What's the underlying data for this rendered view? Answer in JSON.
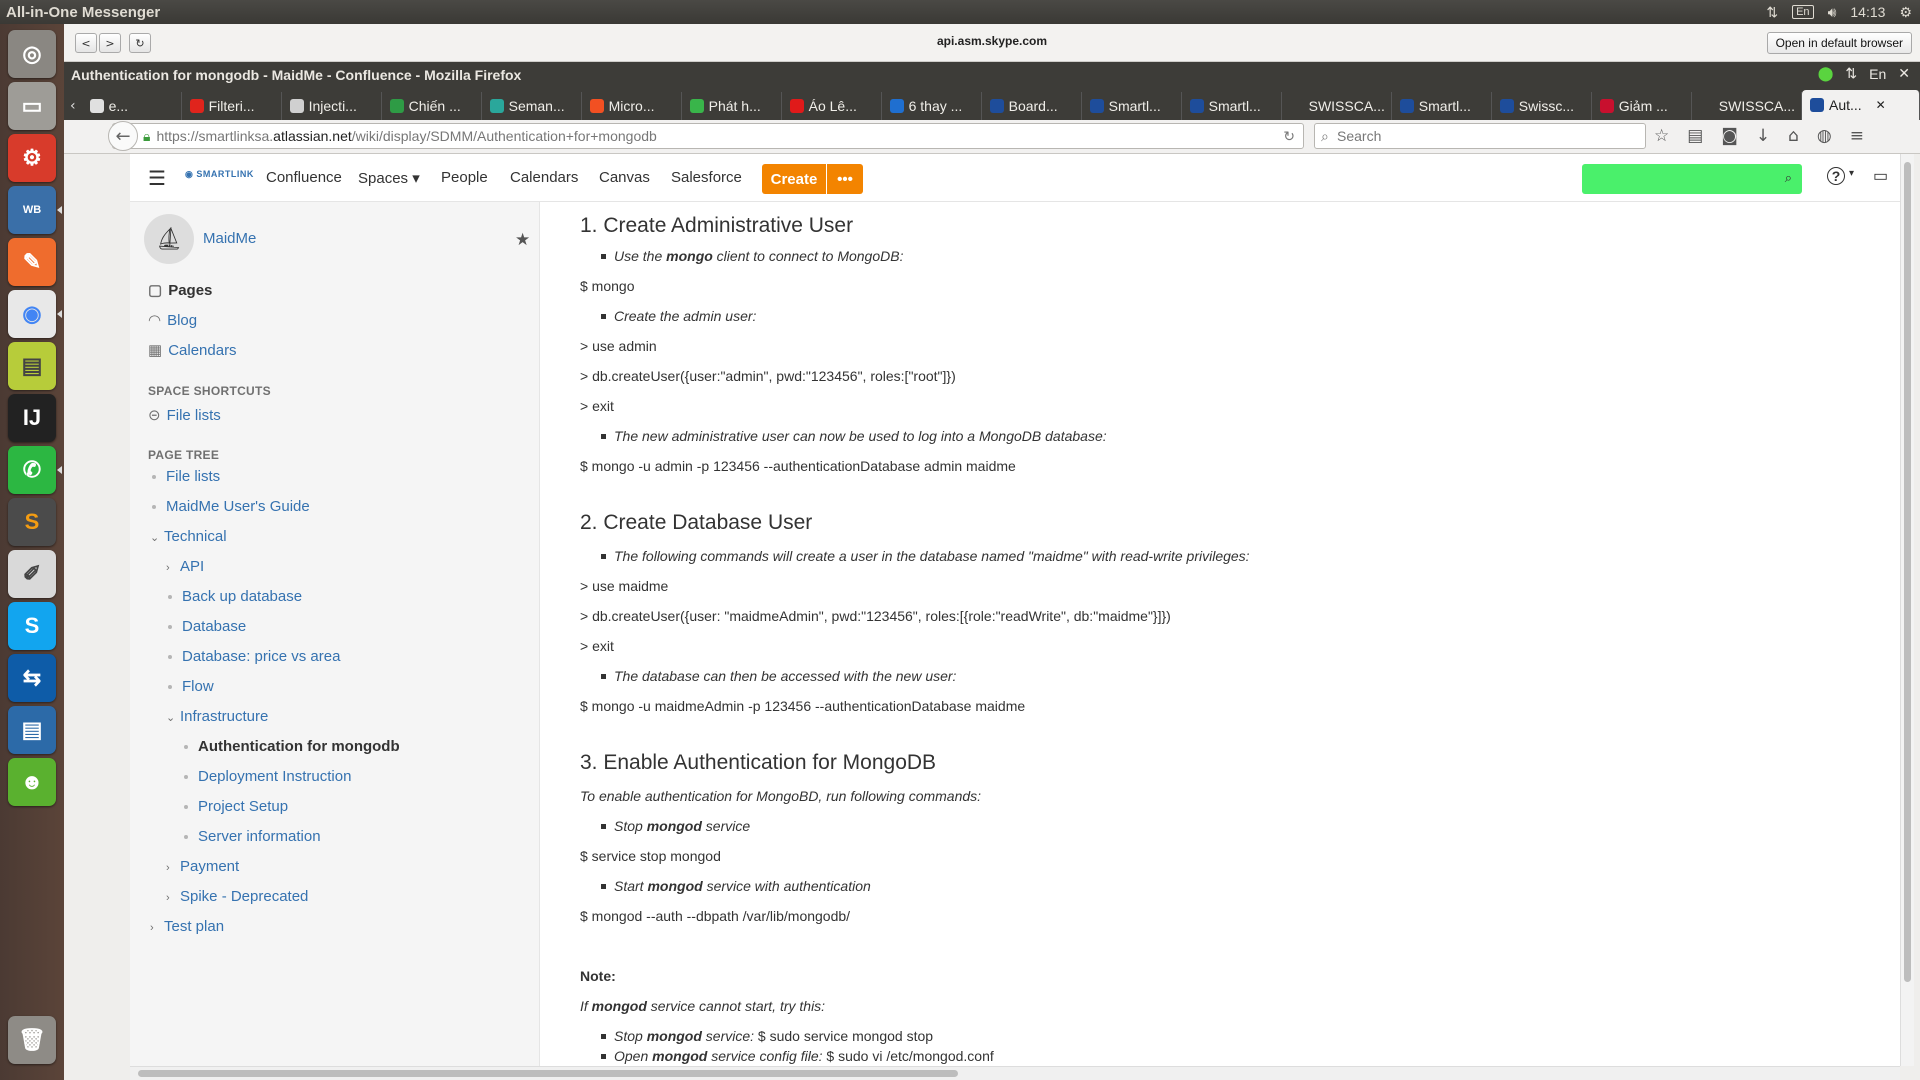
{
  "os": {
    "panel_title": "All-in-One Messenger",
    "lang": "En",
    "clock": "14:13"
  },
  "skype": {
    "url": "api.asm.skype.com",
    "open_default": "Open in default browser",
    "back": "<",
    "forward": ">",
    "reload": "↻"
  },
  "firefox": {
    "window_title": "Authentication for mongodb - MaidMe - Confluence - Mozilla Firefox",
    "address_pre": "https://smartlinksa.",
    "address_host": "atlassian.net",
    "address_post": "/wiki/display/SDMM/Authentication+for+mongodb",
    "search_placeholder": "Search",
    "tabs": [
      {
        "label": "e...",
        "color": "#e0e0e0"
      },
      {
        "label": "Filteri...",
        "color": "#e0241c"
      },
      {
        "label": "Injecti...",
        "color": "#d0d0d0"
      },
      {
        "label": "Chiến ...",
        "color": "#2e9b45"
      },
      {
        "label": "Seman...",
        "color": "#2aa79b"
      },
      {
        "label": "Micro...",
        "color": "#f25022"
      },
      {
        "label": "Phát h...",
        "color": "#39b54a"
      },
      {
        "label": "Áo Lê...",
        "color": "#e01a1a"
      },
      {
        "label": "6 thay ...",
        "color": "#1f6fd0"
      },
      {
        "label": "Board...",
        "color": "#1e4d9b"
      },
      {
        "label": "Smartl...",
        "color": "#1e4d9b"
      },
      {
        "label": "Smartl...",
        "color": "#1e4d9b"
      },
      {
        "label": "SWISSCA...",
        "color": "#3d3c38"
      },
      {
        "label": "Smartl...",
        "color": "#1e4d9b"
      },
      {
        "label": "Swissc...",
        "color": "#1e4d9b"
      },
      {
        "label": "Giảm ...",
        "color": "#c8102e"
      },
      {
        "label": "SWISSCA...",
        "color": "#3d3c38"
      },
      {
        "label": "Aut...",
        "color": "#1e4d9b"
      }
    ]
  },
  "confluence": {
    "brand": "SMARTLINK",
    "nav": [
      "Confluence",
      "Spaces",
      "People",
      "Calendars",
      "Canvas",
      "Salesforce"
    ],
    "create": "Create",
    "create_more": "•••",
    "help": "?",
    "space_name": "MaidMe",
    "sidebar": {
      "pages": "Pages",
      "blog": "Blog",
      "calendars": "Calendars",
      "shortcuts_header": "SPACE SHORTCUTS",
      "file_lists_shortcut": "File lists",
      "tree_header": "PAGE TREE",
      "tree": [
        {
          "label": "File lists"
        },
        {
          "label": "MaidMe User's Guide"
        },
        {
          "label": "Technical"
        },
        {
          "label": "API"
        },
        {
          "label": "Back up database"
        },
        {
          "label": "Database"
        },
        {
          "label": "Database: price vs area"
        },
        {
          "label": "Flow"
        },
        {
          "label": "Infrastructure"
        },
        {
          "label": "Authentication for mongodb"
        },
        {
          "label": "Deployment Instruction"
        },
        {
          "label": "Project Setup"
        },
        {
          "label": "Server information"
        },
        {
          "label": "Payment"
        },
        {
          "label": "Spike - Deprecated"
        },
        {
          "label": "Test plan"
        }
      ]
    },
    "content": {
      "h1": "1. Create Administrative User",
      "l1_pre": "Use the ",
      "l1_bold": "mongo",
      "l1_post": " client to connect to MongoDB:",
      "c1": "$ mongo",
      "l2": "Create the admin user:",
      "c2": "> use admin",
      "c3": "> db.createUser({user:\"admin\", pwd:\"123456\", roles:[\"root\"]})",
      "c4": "> exit",
      "l3": "The new administrative user can now be used to log into a MongoDB database:",
      "c5": "$ mongo -u admin -p 123456 --authenticationDatabase admin maidme",
      "h2": "2. Create Database User",
      "l4": "The following commands will create a user in the database named \"maidme\" with read-write privileges:",
      "c6": "> use maidme",
      "c7": "> db.createUser({user: \"maidmeAdmin\", pwd:\"123456\", roles:[{role:\"readWrite\", db:\"maidme\"}]})",
      "c8": "> exit",
      "l5": "The database can then be accessed with the new user:",
      "c9": "$ mongo -u maidmeAdmin -p 123456 --authenticationDatabase maidme",
      "h3": "3. Enable Authentication for MongoDB",
      "p1": "To enable authentication for MongoBD, run following commands:",
      "l6_pre": "Stop ",
      "l6_bold": "mongod",
      "l6_post": " service",
      "c10": "$ service stop mongod",
      "l7_pre": "Start ",
      "l7_bold": "mongod",
      "l7_post": " service with authentication",
      "c11": "$ mongod --auth --dbpath /var/lib/mongodb/",
      "note": "Note:",
      "n1_pre": "If ",
      "n1_bold": "mongod",
      "n1_post": " service cannot start, try this:",
      "n2_pre": "Stop ",
      "n2_bold": "mongod",
      "n2_mid": " service:",
      "n2_cmd": " $ sudo service mongod stop",
      "n3_pre": "Open ",
      "n3_bold": "mongod",
      "n3_mid": " service config file:",
      "n3_cmd": " $ sudo vi /etc/mongod.conf"
    }
  },
  "launcher_icons": [
    "ubuntu-icon",
    "files-icon",
    "settings-icon",
    "mysql-workbench-icon",
    "postman-icon",
    "chrome-icon",
    "notes-icon",
    "intellij-icon",
    "whatsapp-icon",
    "sublime-icon",
    "text-editor-icon",
    "skype-icon",
    "teamviewer-icon",
    "writer-icon",
    "android-icon",
    "trash-icon"
  ]
}
